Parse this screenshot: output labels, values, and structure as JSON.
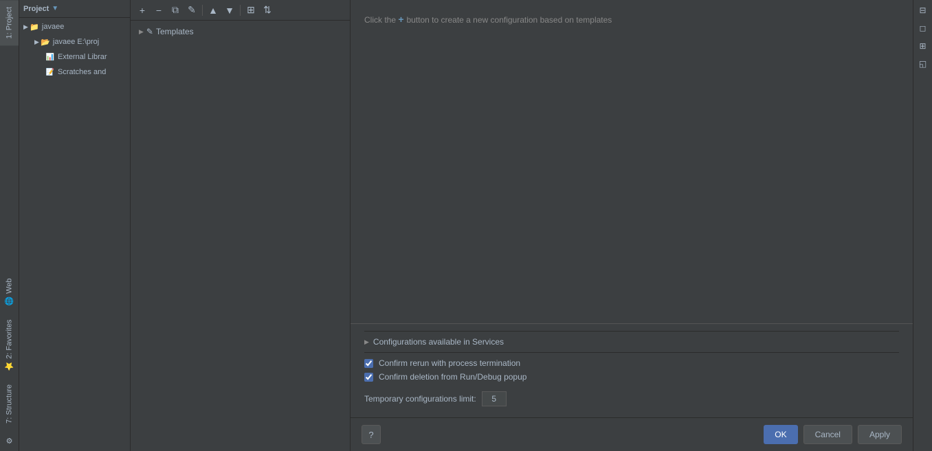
{
  "leftTabs": [
    {
      "id": "project",
      "label": "1: Project"
    },
    {
      "id": "favorites",
      "label": "2: Favorites"
    },
    {
      "id": "structure",
      "label": "7: Structure"
    }
  ],
  "leftBottomTabs": [
    {
      "id": "web",
      "label": "Web"
    }
  ],
  "projectPanel": {
    "header": "Project",
    "items": [
      {
        "label": "javaee",
        "type": "project",
        "indent": 0,
        "arrow": "▶"
      },
      {
        "label": "javaee  E:\\proj",
        "type": "module",
        "indent": 1,
        "arrow": "▶"
      },
      {
        "label": "External Librar",
        "type": "libs",
        "indent": 2,
        "arrow": null
      },
      {
        "label": "Scratches and",
        "type": "scratch",
        "indent": 2,
        "arrow": null
      }
    ]
  },
  "configPanel": {
    "toolbar": {
      "add": "+",
      "remove": "−",
      "copy": "⧉",
      "edit": "✎",
      "up": "▲",
      "down": "▼",
      "moveToGroup": "⊞",
      "sort": "⇅"
    },
    "treeItems": [
      {
        "label": "Templates",
        "arrow": "▶",
        "icon": "✎",
        "selected": false
      }
    ]
  },
  "mainContent": {
    "hint": "Click the",
    "hintPlus": "+",
    "hintSuffix": "button to create a new configuration based on templates"
  },
  "bottomSection": {
    "servicesLabel": "Configurations available in Services",
    "checkboxes": [
      {
        "label": "Confirm rerun with process termination",
        "checked": true
      },
      {
        "label": "Confirm deletion from Run/Debug popup",
        "checked": true
      }
    ],
    "tempConfigLabel": "Temporary configurations limit:",
    "tempConfigValue": "5"
  },
  "footer": {
    "ok": "OK",
    "cancel": "Cancel",
    "apply": "Apply"
  },
  "rightSidebar": {
    "icons": [
      "⊡",
      "◻",
      "⊞",
      "◱"
    ]
  },
  "helpButton": "?"
}
